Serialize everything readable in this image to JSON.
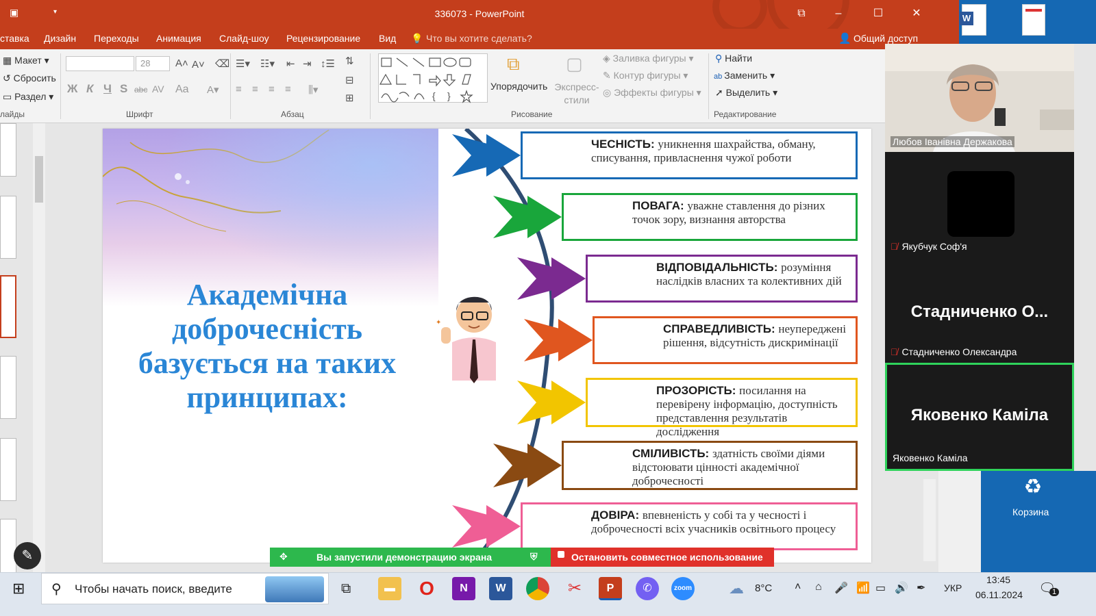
{
  "window": {
    "title": "336073 - PowerPoint"
  },
  "menu": {
    "tabs": [
      "ставка",
      "Дизайн",
      "Переходы",
      "Анимация",
      "Слайд-шоу",
      "Рецензирование",
      "Вид"
    ],
    "tell_me": "Что вы хотите сделать?",
    "share": "Общий доступ"
  },
  "ribbon": {
    "slides": {
      "layout": "Макет",
      "reset": "Сбросить",
      "section": "Раздел",
      "group": "лайды"
    },
    "font": {
      "size": "28",
      "bold": "Ж",
      "italic": "К",
      "underline": "Ч",
      "shadow": "S",
      "strike": "abc",
      "spacing": "AV",
      "case": "Aa",
      "group": "Шрифт"
    },
    "paragraph": {
      "group": "Абзац"
    },
    "drawing": {
      "arrange": "Упорядочить",
      "quick_styles": "Экспресс-стили",
      "fill": "Заливка фигуры",
      "outline": "Контур фигуры",
      "effects": "Эффекты фигуры",
      "group": "Рисование"
    },
    "editing": {
      "find": "Найти",
      "replace": "Заменить",
      "select": "Выделить",
      "group": "Редактирование"
    }
  },
  "slide": {
    "title": "Академічна доброчесність базується на таких принципах:",
    "principles": [
      {
        "keyword": "ЧЕСНІСТЬ:",
        "text": "уникнення шахрайства, обману, списування, привласнення чужої роботи",
        "color": "#1669b5"
      },
      {
        "keyword": "ПОВАГА:",
        "text": "уважне ставлення до різних точок зору, визнання авторства",
        "color": "#19a63b"
      },
      {
        "keyword": "ВІДПОВІДАЛЬНІСТЬ:",
        "text": "розуміння наслідків власних та колективних дій",
        "color": "#7b2a90"
      },
      {
        "keyword": "СПРАВЕДЛИВІСТЬ:",
        "text": "неупереджені рішення, відсутність дискримінації",
        "color": "#e0561f"
      },
      {
        "keyword": "ПРОЗОРІСТЬ:",
        "text": "посилання на перевірену інформацію, доступність представлення результатів дослідження",
        "color": "#f2c500"
      },
      {
        "keyword": "СМІЛИВІСТЬ:",
        "text": "здатність своїми діями відстоювати цінності академічної доброчесності",
        "color": "#8a4a12"
      },
      {
        "keyword": "ДОВІРА:",
        "text": "впевненість у собі та у чесності і доброчесності всіх учасників освітнього процесу",
        "color": "#ef5e95"
      }
    ]
  },
  "participants": [
    {
      "name": "Любов Іванівна Держакова",
      "muted": false,
      "big": ""
    },
    {
      "name": "Якубчук Соф'я",
      "muted": true,
      "big": ""
    },
    {
      "name": "Стадниченко Олександра",
      "muted": true,
      "big": "Стадниченко  О..."
    },
    {
      "name": "Яковенко Каміла",
      "muted": false,
      "big": "Яковенко Каміла"
    }
  ],
  "sharing": {
    "status": "Вы запустили демонстрацию экрана",
    "stop": "Остановить совместное использование"
  },
  "desktop": {
    "recycle_bin": "Корзина"
  },
  "taskbar": {
    "search_placeholder": "Чтобы начать поиск, введите",
    "weather": "8°C",
    "language": "УКР",
    "time": "13:45",
    "date": "06.11.2024",
    "notifications": "1"
  },
  "colors": {
    "powerpoint": "#c43e1c",
    "title_text": "#2a86d6",
    "share_green": "#2db84d",
    "share_red": "#e0312a",
    "active_speaker": "#2fd35b"
  }
}
